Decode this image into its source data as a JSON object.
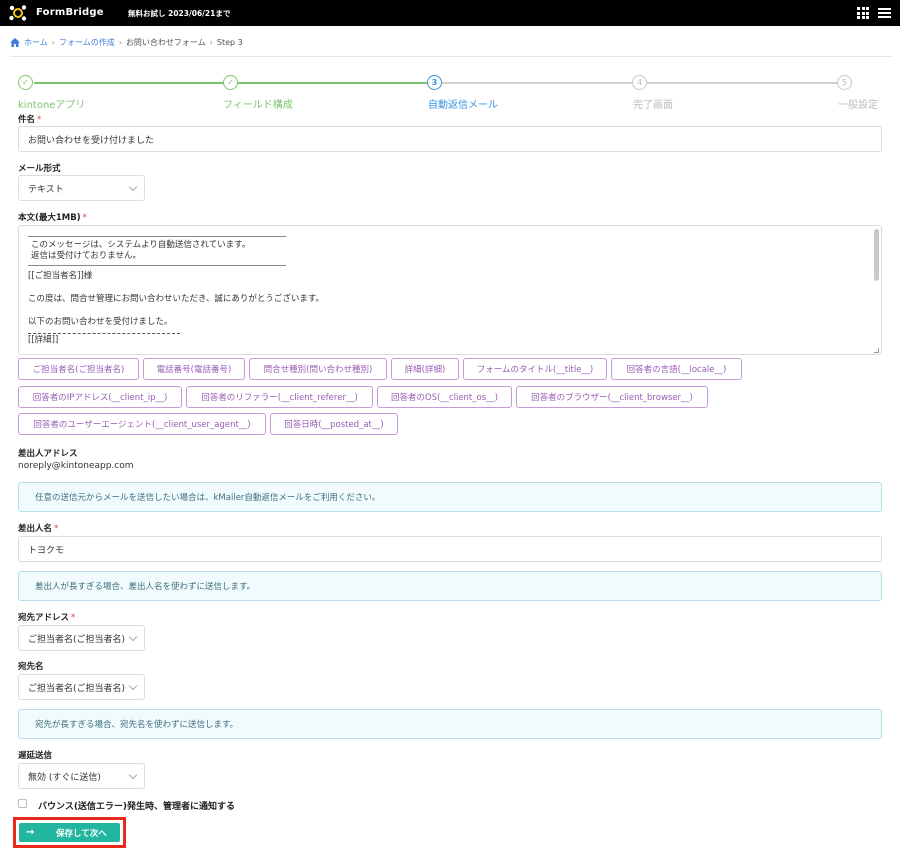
{
  "header": {
    "brand": "FormBridge",
    "trial": "無料お試し 2023/06/21まで",
    "logo_icon": "formbridge-logo-icon",
    "apps_icon": "apps-grid-icon",
    "menu_icon": "hamburger-menu-icon"
  },
  "breadcrumb": {
    "home": "ホーム",
    "create": "フォームの作成",
    "form": "お問い合わせフォーム",
    "step": "Step 3"
  },
  "stepper": {
    "steps": [
      {
        "label": "kintoneアプリ",
        "mark": "✓",
        "state": "done"
      },
      {
        "label": "フィールド構成",
        "mark": "✓",
        "state": "done"
      },
      {
        "label": "自動返信メール",
        "mark": "3",
        "state": "active"
      },
      {
        "label": "完了画面",
        "mark": "4",
        "state": "pending"
      },
      {
        "label": "一般設定",
        "mark": "5",
        "state": "pending"
      }
    ]
  },
  "form": {
    "subject_label": "件名",
    "subject_value": "お問い合わせを受け付けました",
    "mail_format_label": "メール形式",
    "mail_format_value": "テキスト",
    "body_label": "本文(最大1MB)",
    "body_lines": {
      "l1": "このメッセージは、システムより自動送信されています。",
      "l2": "返信は受付けておりません。",
      "l3": "[[ご担当者名]]様",
      "l4": "この度は、問合せ管理にお問い合わせいただき、誠にありがとうございます。",
      "l5": "以下のお問い合わせを受付けました。",
      "l6": "[[詳細]]"
    },
    "required_mark": "*",
    "chips": [
      "ご担当者名(ご担当者名)",
      "電話番号(電話番号)",
      "問合せ種別(問い合わせ種別)",
      "詳細(詳細)",
      "フォームのタイトル(__title__)",
      "回答者の言語(__locale__)",
      "回答者のIPアドレス(__client_ip__)",
      "回答者のリファラー(__client_referer__)",
      "回答者のOS(__client_os__)",
      "回答者のブラウザー(__client_browser__)",
      "回答者のユーザーエージェント(__client_user_agent__)",
      "回答日時(__posted_at__)"
    ],
    "sender_address_label": "差出人アドレス",
    "sender_address_value": "noreply@kintoneapp.com",
    "sender_address_info": "任意の送信元からメールを送信したい場合は、kMailer自動返信メールをご利用ください。",
    "sender_name_label": "差出人名",
    "sender_name_value": "トヨクモ",
    "sender_name_info": "差出人が長すぎる場合、差出人名を使わずに送信します。",
    "to_address_label": "宛先アドレス",
    "to_address_value": "ご担当者名(ご担当者名)",
    "to_name_label": "宛先名",
    "to_name_value": "ご担当者名(ご担当者名)",
    "to_name_info": "宛先が長すぎる場合、宛先名を使わずに送信します。",
    "delay_label": "遅延送信",
    "delay_value": "無効 (すぐに送信)",
    "bounce_label": "バウンス(送信エラー)発生時、管理者に通知する",
    "bounce_checked": false,
    "save_label": "保存して次へ",
    "save_icon": "arrow-right-icon"
  },
  "colors": {
    "done": "#7cc56f",
    "active": "#3a93e0",
    "chip": "#9a5bb5",
    "save": "#22b5a0",
    "highlight": "#e8291c"
  }
}
